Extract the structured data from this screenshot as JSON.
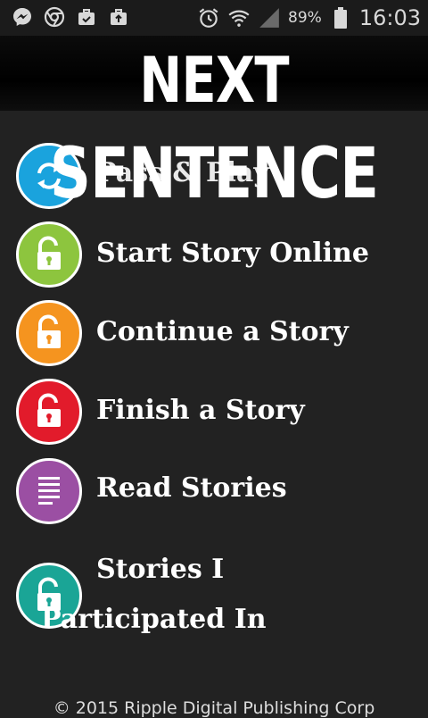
{
  "status_bar": {
    "battery": "89%",
    "time": "16:03",
    "left_icons": [
      "messenger-icon",
      "chrome-icon",
      "briefcase-check-icon",
      "briefcase-upload-icon"
    ],
    "right_icons": [
      "alarm-icon",
      "wifi-icon",
      "signal-icon",
      "battery-icon"
    ]
  },
  "header": {
    "logo_line1": "NEXT",
    "logo_line2": "SENTENCE"
  },
  "menu": {
    "items": [
      {
        "label": "Pass & Play",
        "icon": "sync-arrows-icon",
        "color": "#1aa3dd"
      },
      {
        "label": "Start Story Online",
        "icon": "unlock-icon",
        "color": "#8dc53e"
      },
      {
        "label": "Continue a Story",
        "icon": "unlock-icon",
        "color": "#f5941f"
      },
      {
        "label": "Finish a Story",
        "icon": "unlock-icon",
        "color": "#e21b2b"
      },
      {
        "label": "Read Stories",
        "icon": "document-lines-icon",
        "color": "#9b4fa3"
      },
      {
        "label_line1": "Stories I",
        "label_line2": "Participated In",
        "icon": "unlock-icon",
        "color": "#1aa596"
      }
    ]
  },
  "footer": {
    "copyright": "© 2015 Ripple Digital Publishing Corp"
  }
}
